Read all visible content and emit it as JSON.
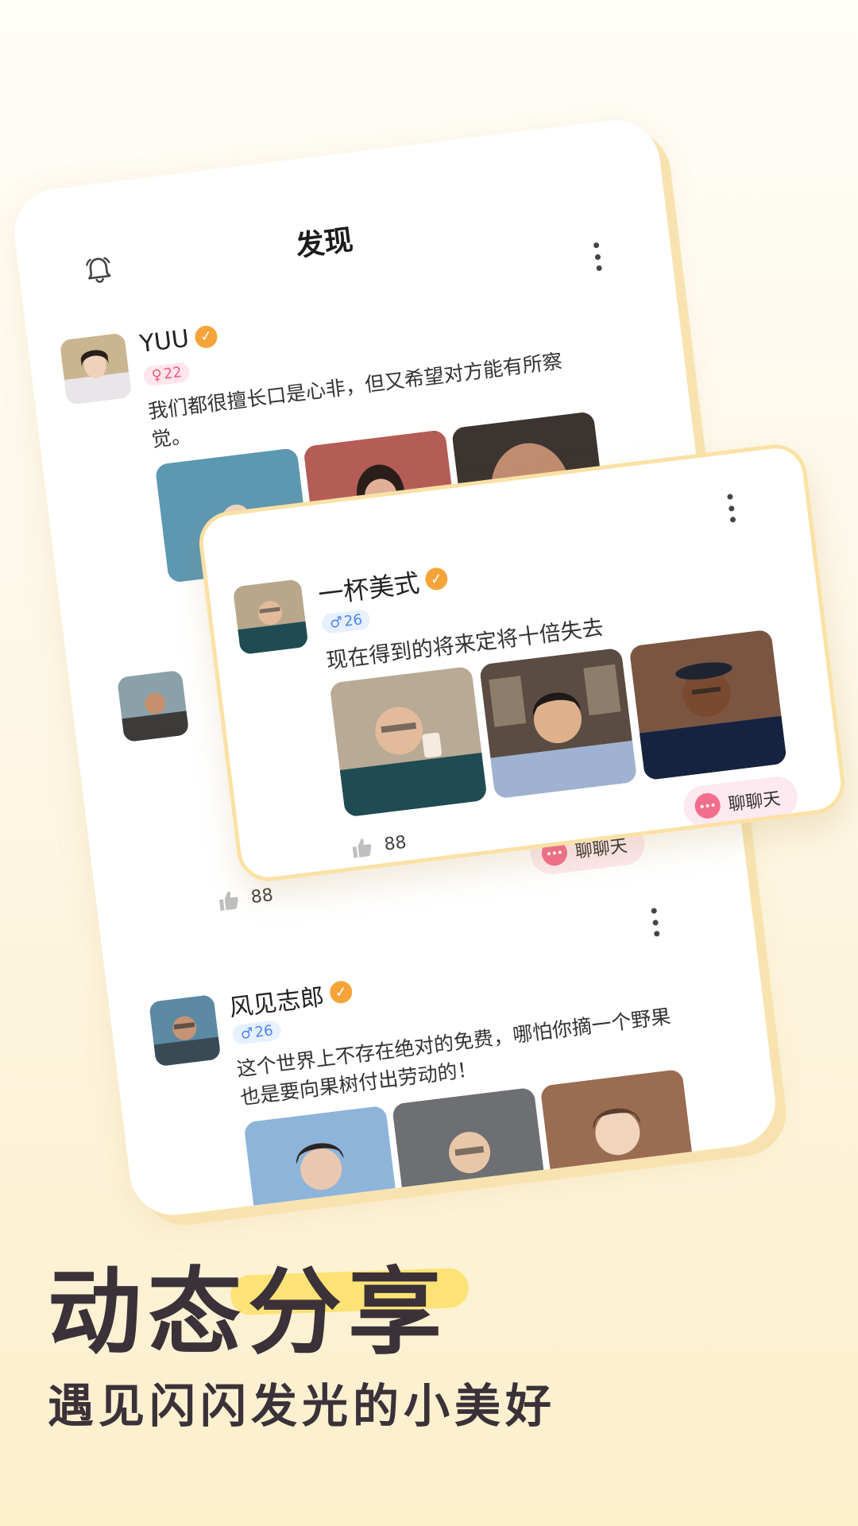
{
  "page": {
    "title": "发现"
  },
  "posts": [
    {
      "username": "YUU",
      "gender": "♀",
      "age": "22",
      "text": "我们都很擅长口是心非，但又希望对方能有所察觉。",
      "likes": "88",
      "chat_label": "聊聊天"
    },
    {
      "username": "一杯美式",
      "gender": "♂",
      "age": "26",
      "text": "现在得到的将来定将十倍失去",
      "likes": "88",
      "chat_label": "聊聊天"
    },
    {
      "username": "风见志郎",
      "gender": "♂",
      "age": "26",
      "text": "这个世界上不存在绝对的免费，哪怕你摘一个野果也是要向果树付出劳动的！"
    }
  ],
  "promo": {
    "headline": "动态分享",
    "subline": "遇见闪闪发光的小美好"
  },
  "colors": {
    "accent_yellow": "#fde06a",
    "chat_pink": "#f36d8f",
    "verified_orange": "#f6a43a"
  }
}
